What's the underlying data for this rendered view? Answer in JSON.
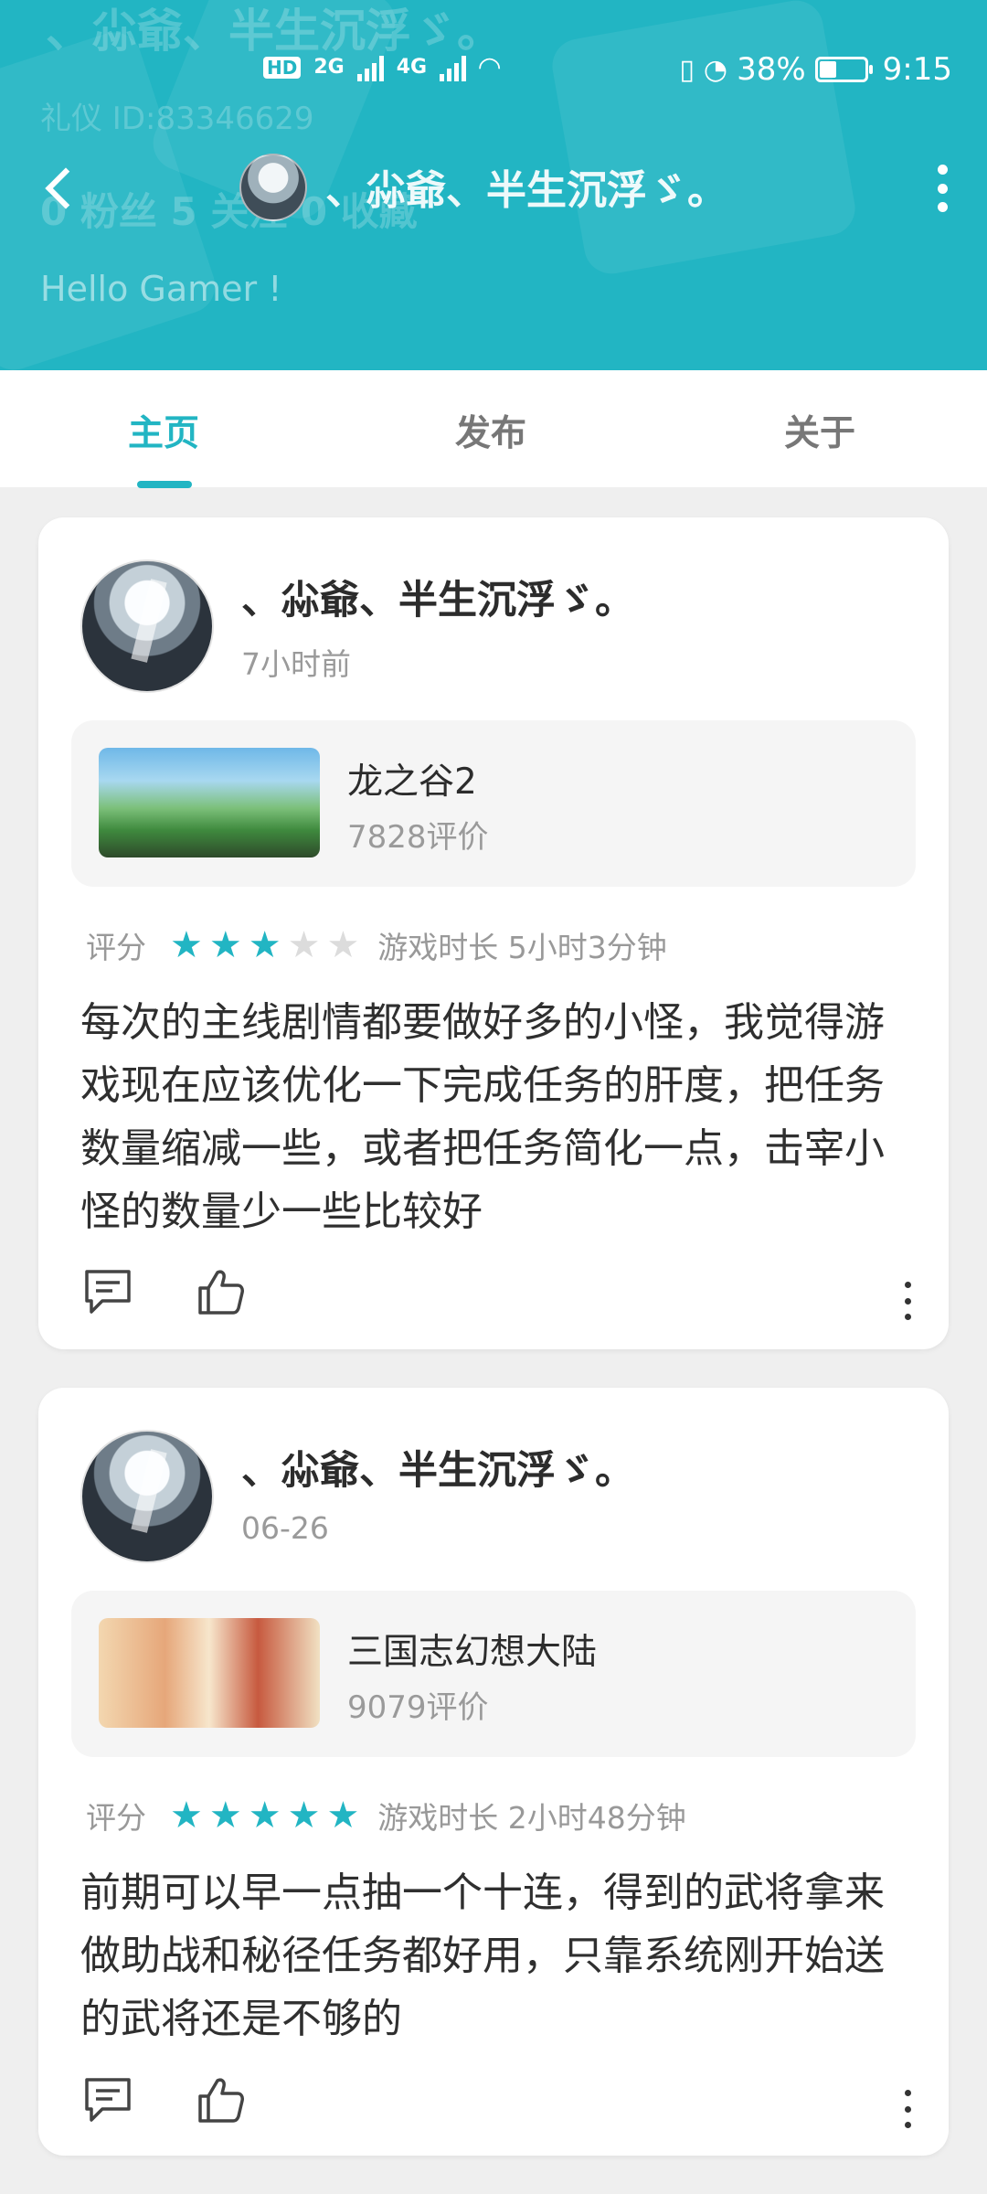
{
  "status_bar": {
    "hd": "HD",
    "net1": "2G",
    "net2": "4G",
    "battery": "38%",
    "time": "9:15"
  },
  "header": {
    "title": "、尛爺、半生沉浮ゞ。",
    "ghost_name": "、尛爺、半生沉浮ゞ。",
    "ghost_id": "礼仪 ID:83346629",
    "ghost_stats": "0 粉丝   5   关注  0 收藏",
    "greeting": "Hello Gamer !"
  },
  "tabs": [
    {
      "label": "主页"
    },
    {
      "label": "发布"
    },
    {
      "label": "关于"
    }
  ],
  "reviews": [
    {
      "user": "、尛爺、半生沉浮ゞ。",
      "time": "7小时前",
      "game": {
        "name": "龙之谷2",
        "reviews": "7828评价"
      },
      "rating_label": "评分",
      "stars": 3,
      "playtime": "游戏时长 5小时3分钟",
      "text": "每次的主线剧情都要做好多的小怪，我觉得游戏现在应该优化一下完成任务的肝度，把任务数量缩减一些，或者把任务简化一点，击宰小怪的数量少一些比较好"
    },
    {
      "user": "、尛爺、半生沉浮ゞ。",
      "time": "06-26",
      "game": {
        "name": "三国志幻想大陆",
        "reviews": "9079评价"
      },
      "rating_label": "评分",
      "stars": 5,
      "playtime": "游戏时长 2小时48分钟",
      "text": "前期可以早一点抽一个十连，得到的武将拿来做助战和秘径任务都好用，只靠系统刚开始送的武将还是不够的"
    }
  ],
  "colors": {
    "accent": "#22b5c3",
    "background": "#efefef",
    "card": "#ffffff"
  }
}
